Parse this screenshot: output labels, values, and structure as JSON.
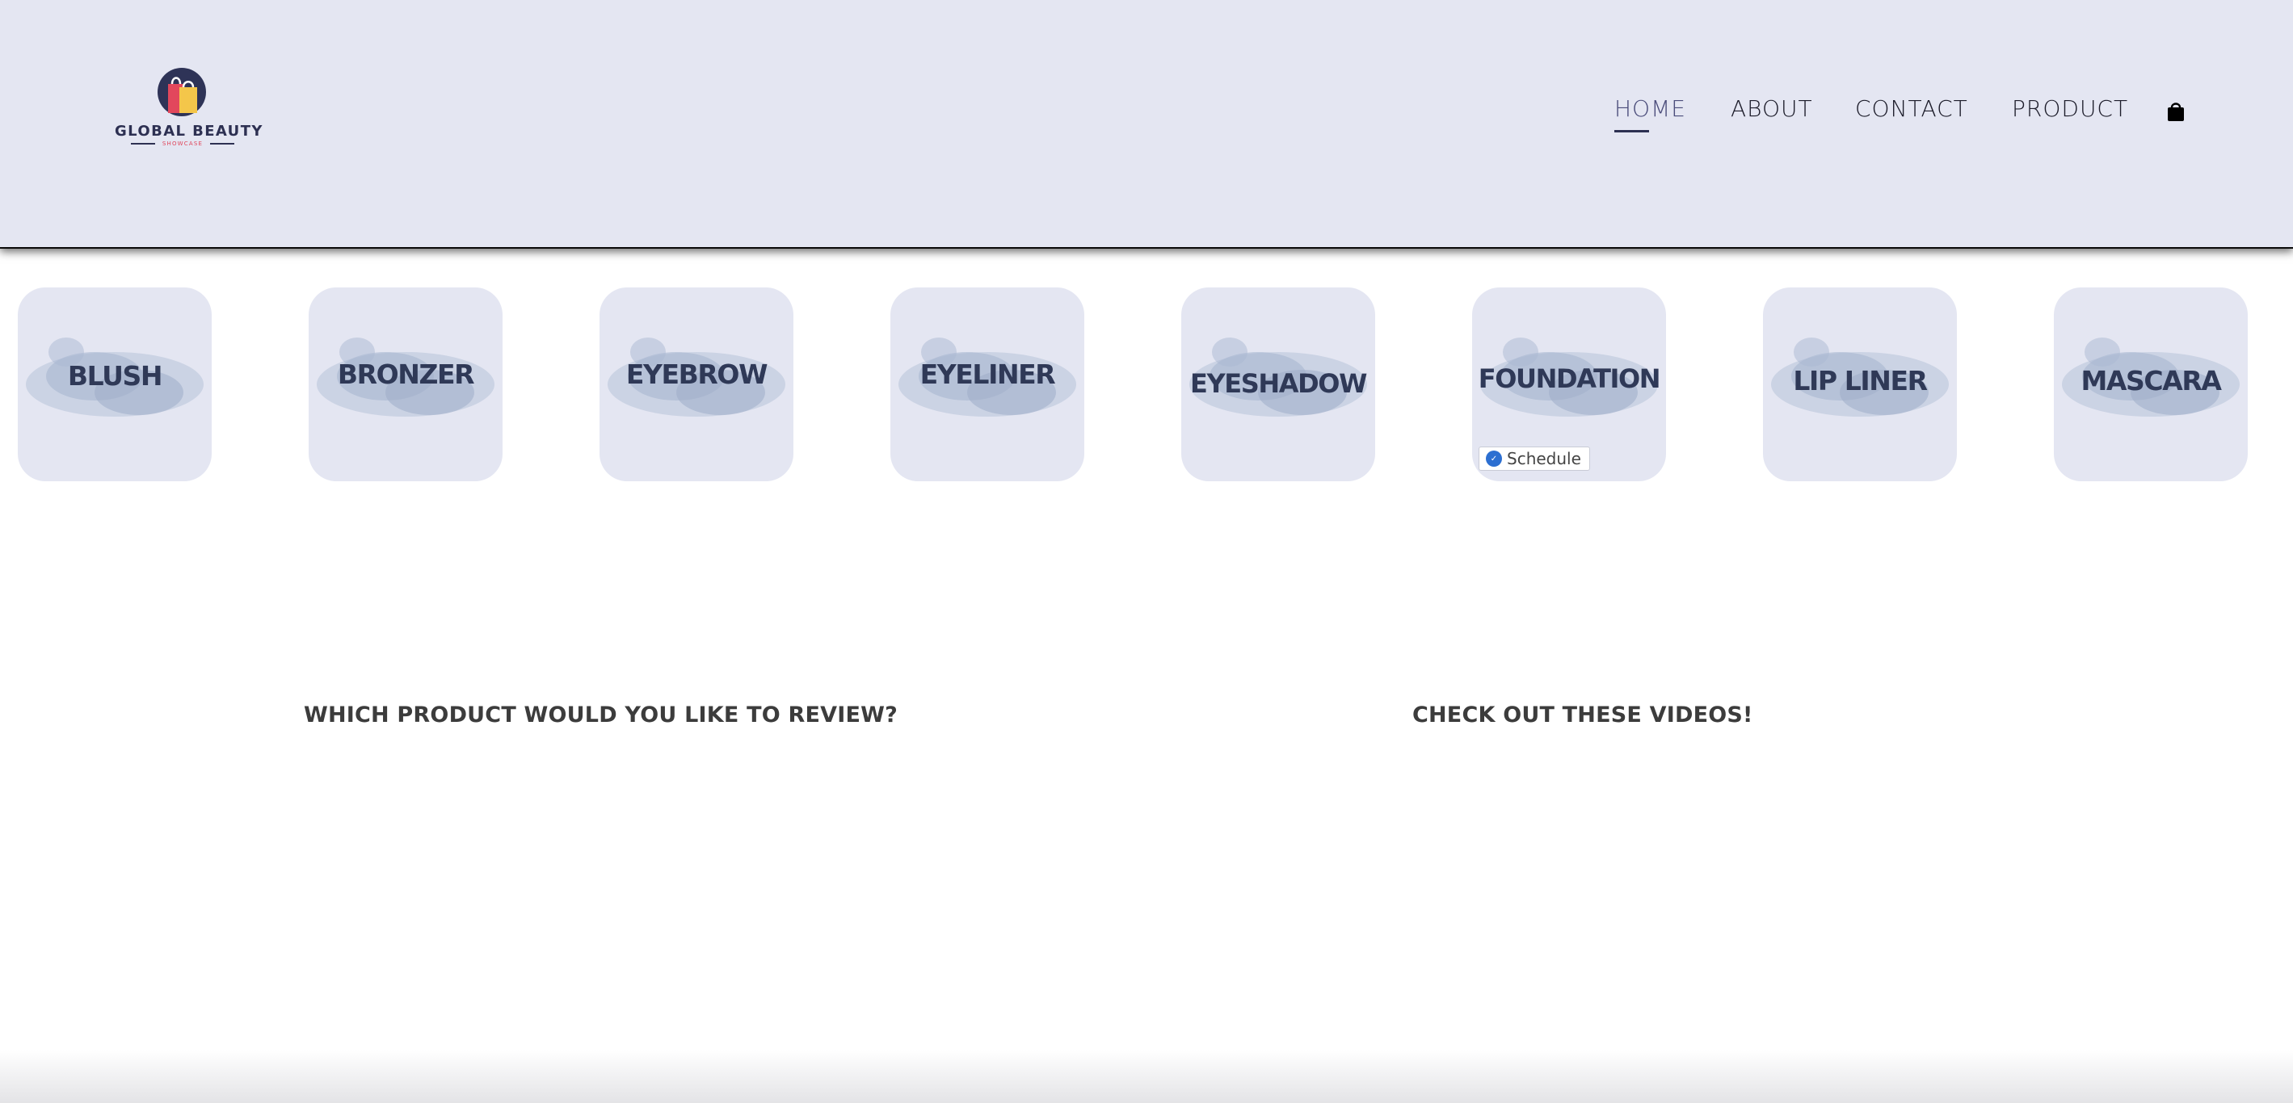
{
  "brand": {
    "name": "GLOBAL BEAUTY",
    "tagline": "SHOWCASE"
  },
  "nav": {
    "items": [
      {
        "label": "HOME"
      },
      {
        "label": "ABOUT"
      },
      {
        "label": "CONTACT"
      },
      {
        "label": "PRODUCT"
      }
    ],
    "active": "HOME",
    "cart_icon": "shopping-bag-icon"
  },
  "categories": [
    {
      "label": "BLUSH"
    },
    {
      "label": "BRONZER"
    },
    {
      "label": "EYEBROW"
    },
    {
      "label": "EYELINER"
    },
    {
      "label": "EYESHADOW"
    },
    {
      "label": "FOUNDATION"
    },
    {
      "label": "LIP LINER"
    },
    {
      "label": "MASCARA"
    }
  ],
  "schedule_widget": {
    "label": "Schedule",
    "icon": "calendar-badge-icon"
  },
  "sections": {
    "review_heading": "WHICH PRODUCT WOULD YOU LIKE TO REVIEW?",
    "videos_heading": "CHECK OUT THESE VIDEOS!"
  },
  "colors": {
    "header_bg": "#e4e6f2",
    "tile_bg": "#e4e6f2",
    "tile_text": "#2f3957",
    "nav_text": "#1c1c2a",
    "accent": "#2d3052"
  }
}
